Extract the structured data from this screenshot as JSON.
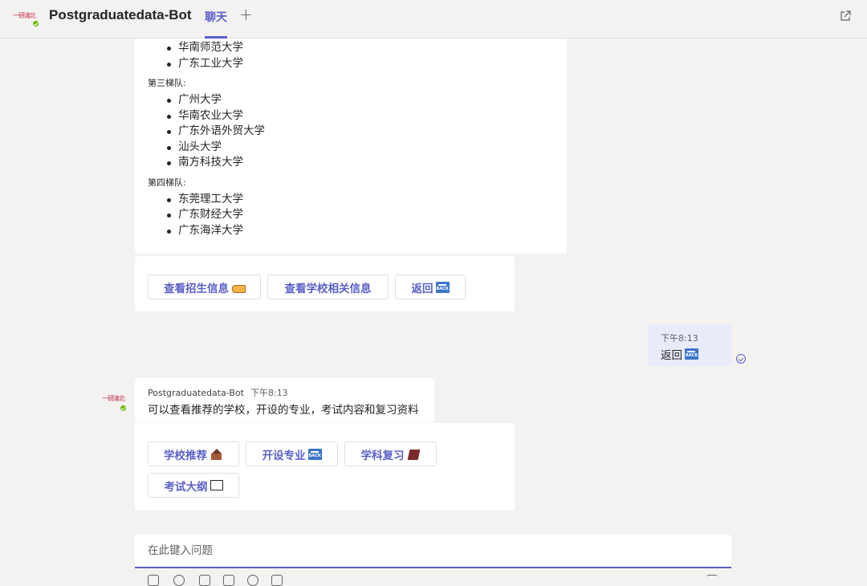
{
  "header": {
    "bot_name": "Postgraduatedata-Bot",
    "tab_chat": "聊天",
    "tab_add": "+"
  },
  "bot": {
    "logo_text": "一研清北"
  },
  "universities_card": {
    "top_items": [
      "华南师范大学",
      "广东工业大学"
    ],
    "tier3_label": "第三梯队:",
    "tier3_items": [
      "广州大学",
      "华南农业大学",
      "广东外语外贸大学",
      "汕头大学",
      "南方科技大学"
    ],
    "tier4_label": "第四梯队:",
    "tier4_items": [
      "东莞理工大学",
      "广东财经大学",
      "广东海洋大学"
    ]
  },
  "actions_card_1": {
    "view_admission": "查看招生信息",
    "view_school_info": "查看学校相关信息",
    "back": "返回"
  },
  "user_message": {
    "time": "下午8:13",
    "text": "返回"
  },
  "bot_message": {
    "sender": "Postgraduatedata-Bot",
    "time": "下午8:13",
    "text": "可以查看推荐的学校，开设的专业，考试内容和复习资料"
  },
  "actions_card_2": {
    "school_recommend": "学校推荐",
    "majors": "开设专业",
    "subject_review": "学科复习",
    "exam_outline": "考试大纲"
  },
  "compose": {
    "placeholder": "在此键入问题"
  },
  "icons": {
    "popout": "popout-icon",
    "online": "online-status-icon",
    "read": "read-receipt-icon"
  },
  "colors": {
    "accent": "#5b5fc7",
    "bubble_mine": "#e8ebfa",
    "background": "#f3f2f1"
  }
}
